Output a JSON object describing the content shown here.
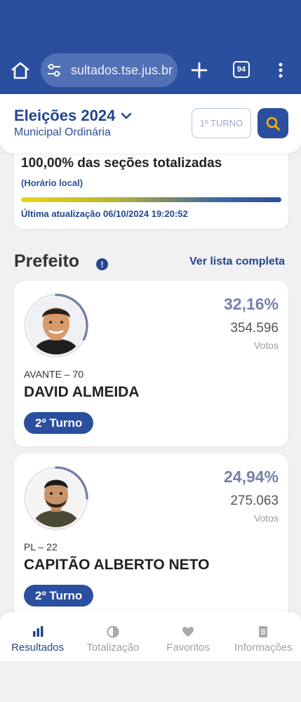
{
  "browser": {
    "url": "resultados.tse.jus.br",
    "tab_count": "94"
  },
  "header": {
    "title": "Eleições 2024",
    "subtitle": "Municipal Ordinária",
    "turno_label": "1º TURNO"
  },
  "status": {
    "title": "100,00% das seções totalizadas",
    "local_time": "(Horário local)",
    "progress_percent": 100,
    "last_update": "Última atualização 06/10/2024 19:20:52"
  },
  "section": {
    "title": "Prefeito",
    "info_symbol": "!",
    "see_all": "Ver lista completa"
  },
  "candidates": [
    {
      "percent": "32,16%",
      "votes": "354.596",
      "votes_label": "Votos",
      "party": "AVANTE – 70",
      "name": "DAVID ALMEIDA",
      "badge": "2º Turno",
      "ring_fraction": 0.3216
    },
    {
      "percent": "24,94%",
      "votes": "275.063",
      "votes_label": "Votos",
      "party": "PL – 22",
      "name": "CAPITÃO ALBERTO NETO",
      "badge": "2º Turno",
      "ring_fraction": 0.2494
    }
  ],
  "nav": [
    {
      "label": "Resultados",
      "icon": "bar-chart-icon",
      "active": true
    },
    {
      "label": "Totalização",
      "icon": "pie-icon",
      "active": false
    },
    {
      "label": "Favoritos",
      "icon": "heart-icon",
      "active": false
    },
    {
      "label": "Informações",
      "icon": "document-icon",
      "active": false
    }
  ],
  "colors": {
    "brand_blue": "#2a4f9e",
    "dark_blue": "#24468f",
    "percent_gray": "#7681a9"
  }
}
